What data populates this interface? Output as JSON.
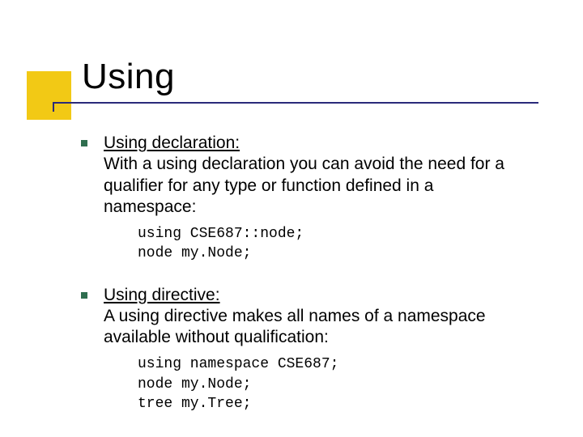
{
  "title": "Using",
  "items": [
    {
      "heading": "Using declaration:",
      "desc": "With a using declaration you can avoid the need for a qualifier for any type or function defined in a namespace:",
      "code": "using CSE687::node;\nnode my.Node;"
    },
    {
      "heading": "Using directive:",
      "desc": "A using directive makes all names of a namespace available without qualification:",
      "code": "using namespace CSE687;\nnode my.Node;\ntree my.Tree;"
    }
  ]
}
